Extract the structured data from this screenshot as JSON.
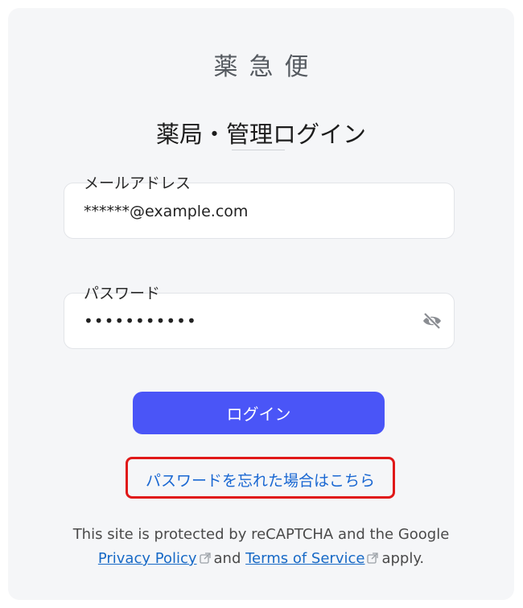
{
  "brand": {
    "logo_text": "薬急便"
  },
  "page": {
    "title": "薬局・管理ログイン"
  },
  "email": {
    "label": "メールアドレス",
    "value": "******@example.com"
  },
  "password": {
    "label": "パスワード",
    "value": "•••••••••••"
  },
  "actions": {
    "login_label": "ログイン",
    "forgot_label": "パスワードを忘れた場合はこちら"
  },
  "recaptcha": {
    "line1": "This site is protected by reCAPTCHA and the Google",
    "privacy_label": "Privacy Policy",
    "and_text": "and",
    "terms_label": "Terms of Service",
    "apply_text": "apply."
  },
  "colors": {
    "primary": "#4a55f7",
    "link": "#1769c6",
    "highlight_border": "#e01818",
    "card_bg": "#f5f6f8"
  },
  "icons": {
    "password_toggle": "eye-off-icon",
    "external_link": "external-link-icon"
  }
}
